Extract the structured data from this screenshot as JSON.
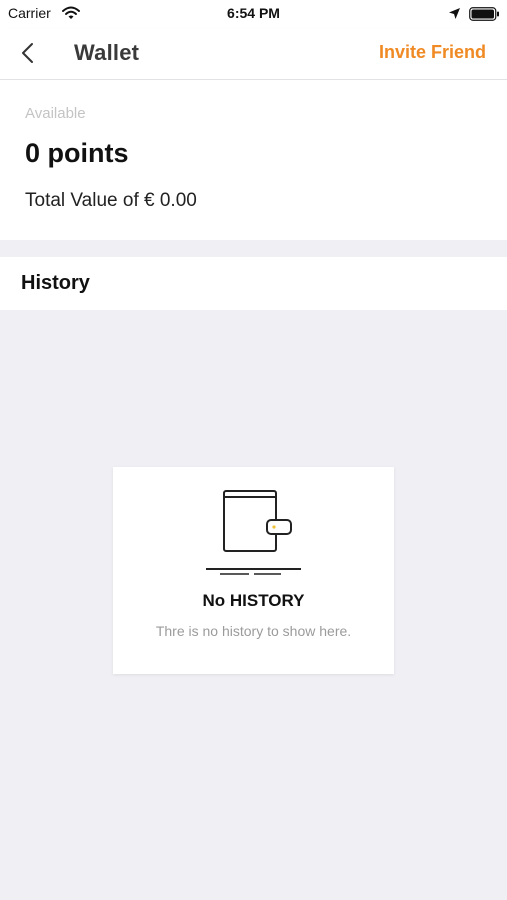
{
  "status_bar": {
    "carrier": "Carrier",
    "time": "6:54 PM",
    "icons": [
      "wifi-icon",
      "location-icon",
      "battery-icon"
    ]
  },
  "nav": {
    "back_icon": "chevron-left-icon",
    "title": "Wallet",
    "invite_label": "Invite Friend"
  },
  "wallet": {
    "available_label": "Available",
    "points": "0 points",
    "total_value": "Total Value of € 0.00"
  },
  "history": {
    "title": "History",
    "empty_icon": "wallet-icon",
    "empty_title": "No HISTORY",
    "empty_subtitle": "Thre is no history to show here."
  },
  "colors": {
    "accent": "#f08a24",
    "background": "#efeff4",
    "card": "#ffffff",
    "muted_text": "#9b9b9b"
  }
}
